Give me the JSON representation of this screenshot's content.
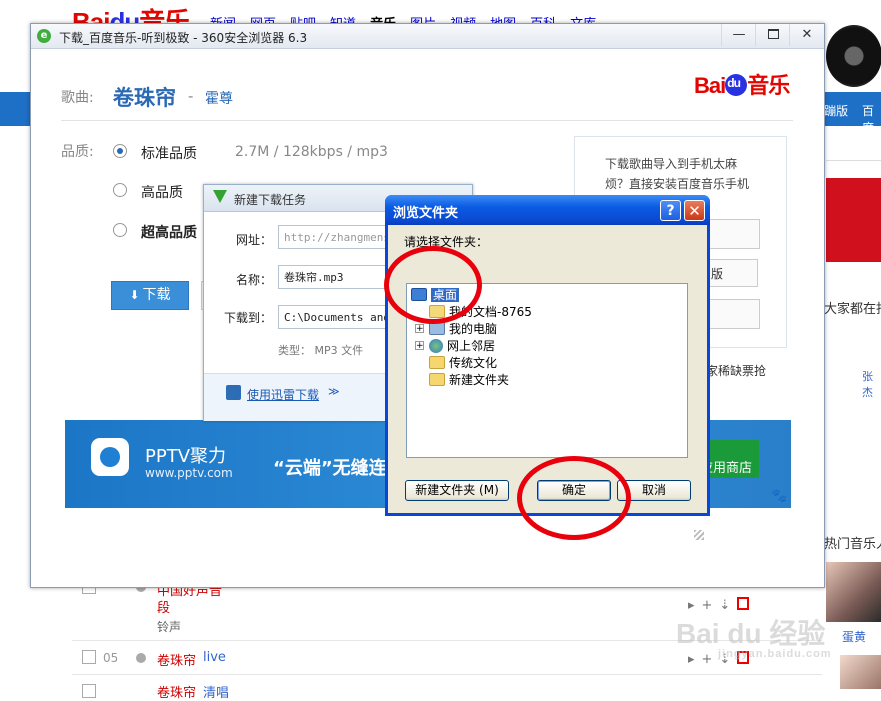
{
  "background_page": {
    "logo_text": "Bai",
    "logo_du": "du",
    "logo_suffix": "音乐",
    "nav": [
      "新闻",
      "网页",
      "贴吧",
      "知道",
      "音乐",
      "图片",
      "视频",
      "地图",
      "百科",
      "文库"
    ],
    "nav_active": "音乐",
    "bar_right_1": "ᵢ蹦版",
    "bar_right_2": "百度",
    "side_text_1": "大家都在找",
    "side_link_1": "张杰",
    "side_text_2": "热门音乐人",
    "side_artist": "蛋黄",
    "rows": [
      {
        "num": "",
        "title": "中国好声音",
        "sub_title": "段",
        "sub": "铃声"
      },
      {
        "num": "05",
        "title": "卷珠帘",
        "tag": "live"
      },
      {
        "num": "",
        "title": "卷珠帘",
        "tag": "清唱"
      }
    ],
    "watermark": "Bai du 经验",
    "watermark_url": "jingyan.baidu.com"
  },
  "browser_window": {
    "title": "下载_百度音乐-听到极致 - 360安全浏览器 6.3",
    "min_label": "—",
    "close_label": "✕",
    "song_label": "歌曲:",
    "song_name": "卷珠帘",
    "separator": "-",
    "artist": "霍尊",
    "logo_text": "Bai",
    "logo_suffix": "音乐",
    "quality_label": "品质:",
    "qualities": [
      {
        "label": "标准品质",
        "info": "2.7M / 128kbps / mp3",
        "selected": true
      },
      {
        "label": "高品质",
        "info": "",
        "selected": false
      },
      {
        "label": "超高品质",
        "info": "",
        "selected": false
      }
    ],
    "download_button": "下载",
    "promo_line_1": "下载歌曲导入到手机太麻",
    "promo_line_2": "烦？直接安装百度音乐手机",
    "promo_button_2": "版",
    "promo_line_3": "家稀缺票抢",
    "ad_name": "PPTV聚力",
    "ad_url": "www.pptv.com",
    "ad_slogan": "“云端”无缝连",
    "ad_store": "应用商店"
  },
  "new_task_dialog": {
    "title": "新建下载任务",
    "url_label": "网址：",
    "url_value": "http://zhangmenshiting.baidu.com",
    "name_label": "名称：",
    "name_value": "卷珠帘.mp3",
    "save_label": "下载到：",
    "save_value": "C:\\Documents and Settings",
    "type_text": "类型： MP3 文件",
    "thunder_link": "使用迅雷下载",
    "chevron": "≫"
  },
  "browse_folder_dialog": {
    "title": "浏览文件夹",
    "help": "?",
    "close": "✕",
    "prompt": "请选择文件夹：",
    "tree": [
      {
        "label": "桌面",
        "icon": "desktop-icon",
        "selected": true
      },
      {
        "label": "我的文档-8765",
        "icon": "my-documents-icon",
        "expander": ""
      },
      {
        "label": "我的电脑",
        "icon": "my-computer-icon",
        "expander": "+"
      },
      {
        "label": "网上邻居",
        "icon": "network-icon",
        "expander": "+"
      },
      {
        "label": "传统文化",
        "icon": "folder-icon",
        "expander": ""
      },
      {
        "label": "新建文件夹",
        "icon": "folder-icon",
        "expander": ""
      }
    ],
    "new_folder_button": "新建文件夹 (M)",
    "ok_button": "确定",
    "cancel_button": "取消"
  },
  "colors": {
    "annotation_red": "#e8000c",
    "xp_title_blue": "#0a49d2",
    "baidu_blue": "#2b69b5"
  }
}
